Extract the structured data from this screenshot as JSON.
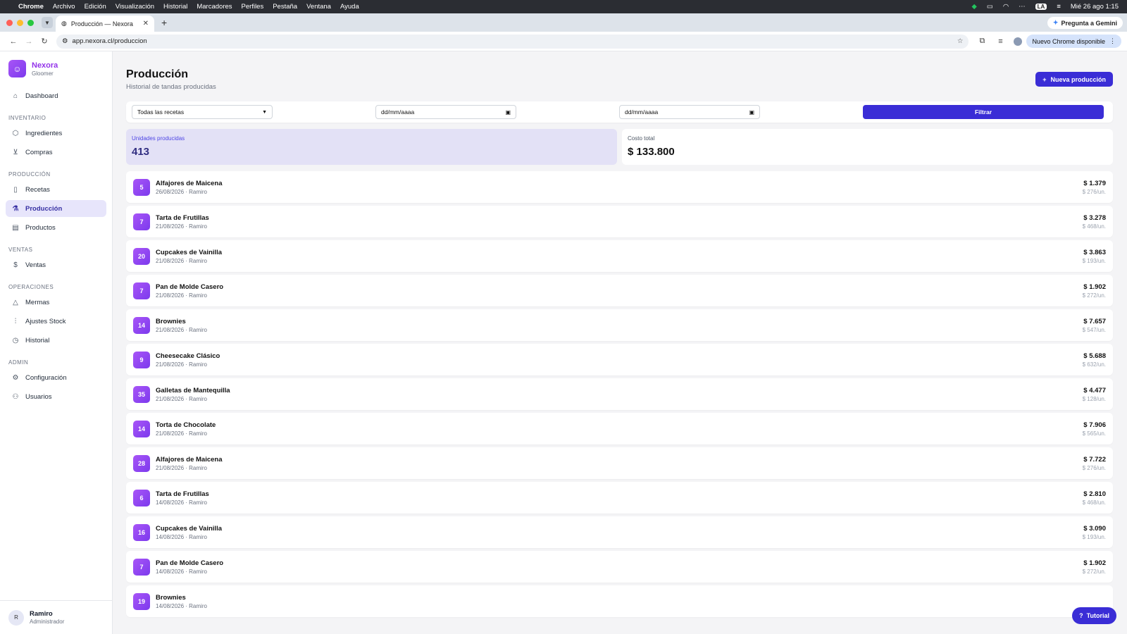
{
  "menubar": {
    "app": "Chrome",
    "items": [
      "Archivo",
      "Edición",
      "Visualización",
      "Historial",
      "Marcadores",
      "Perfiles",
      "Pestaña",
      "Ventana",
      "Ayuda"
    ],
    "input_badge": "LA",
    "datetime": "Mié 26 ago 1:15"
  },
  "browser": {
    "tab_title": "Producción — Nexora",
    "gemini": "Pregunta a Gemini",
    "url": "app.nexora.cl/produccion",
    "update": "Nuevo Chrome disponible"
  },
  "brand": {
    "name": "Nexora",
    "sub": "Gloomer"
  },
  "nav": {
    "dashboard": "Dashboard",
    "inventario": "INVENTARIO",
    "ingredientes": "Ingredientes",
    "compras": "Compras",
    "produccion_section": "PRODUCCIÓN",
    "recetas": "Recetas",
    "produccion": "Producción",
    "productos": "Productos",
    "ventas_section": "VENTAS",
    "ventas": "Ventas",
    "operaciones": "OPERACIONES",
    "mermas": "Mermas",
    "ajustes": "Ajustes Stock",
    "historial": "Historial",
    "admin": "ADMIN",
    "configuracion": "Configuración",
    "usuarios": "Usuarios"
  },
  "user": {
    "initial": "R",
    "name": "Ramiro",
    "role": "Administrador"
  },
  "page": {
    "title": "Producción",
    "subtitle": "Historial de tandas producidas",
    "new_button": "Nueva producción"
  },
  "filters": {
    "recipe": "Todas las recetas",
    "date_from": "dd/mm/aaaa",
    "date_to": "dd/mm/aaaa",
    "button": "Filtrar"
  },
  "stats": {
    "units_label": "Unidades producidas",
    "units_value": "413",
    "cost_label": "Costo total",
    "cost_value": "$ 133.800"
  },
  "rows": [
    {
      "qty": "5",
      "name": "Alfajores de Maicena",
      "meta": "26/08/2026 · Ramiro",
      "cost": "$ 1.379",
      "unit": "$ 276/un."
    },
    {
      "qty": "7",
      "name": "Tarta de Frutillas",
      "meta": "21/08/2026 · Ramiro",
      "cost": "$ 3.278",
      "unit": "$ 468/un."
    },
    {
      "qty": "20",
      "name": "Cupcakes de Vainilla",
      "meta": "21/08/2026 · Ramiro",
      "cost": "$ 3.863",
      "unit": "$ 193/un."
    },
    {
      "qty": "7",
      "name": "Pan de Molde Casero",
      "meta": "21/08/2026 · Ramiro",
      "cost": "$ 1.902",
      "unit": "$ 272/un."
    },
    {
      "qty": "14",
      "name": "Brownies",
      "meta": "21/08/2026 · Ramiro",
      "cost": "$ 7.657",
      "unit": "$ 547/un."
    },
    {
      "qty": "9",
      "name": "Cheesecake Clásico",
      "meta": "21/08/2026 · Ramiro",
      "cost": "$ 5.688",
      "unit": "$ 632/un."
    },
    {
      "qty": "35",
      "name": "Galletas de Mantequilla",
      "meta": "21/08/2026 · Ramiro",
      "cost": "$ 4.477",
      "unit": "$ 128/un."
    },
    {
      "qty": "14",
      "name": "Torta de Chocolate",
      "meta": "21/08/2026 · Ramiro",
      "cost": "$ 7.906",
      "unit": "$ 565/un."
    },
    {
      "qty": "28",
      "name": "Alfajores de Maicena",
      "meta": "21/08/2026 · Ramiro",
      "cost": "$ 7.722",
      "unit": "$ 276/un."
    },
    {
      "qty": "6",
      "name": "Tarta de Frutillas",
      "meta": "14/08/2026 · Ramiro",
      "cost": "$ 2.810",
      "unit": "$ 468/un."
    },
    {
      "qty": "16",
      "name": "Cupcakes de Vainilla",
      "meta": "14/08/2026 · Ramiro",
      "cost": "$ 3.090",
      "unit": "$ 193/un."
    },
    {
      "qty": "7",
      "name": "Pan de Molde Casero",
      "meta": "14/08/2026 · Ramiro",
      "cost": "$ 1.902",
      "unit": "$ 272/un."
    },
    {
      "qty": "19",
      "name": "Brownies",
      "meta": "14/08/2026 · Ramiro",
      "cost": "",
      "unit": ""
    }
  ],
  "tutorial": "Tutorial",
  "colors": {
    "primary": "#3a2dd6",
    "brand": "#9333ea",
    "highlight": "#e3e1f6"
  }
}
